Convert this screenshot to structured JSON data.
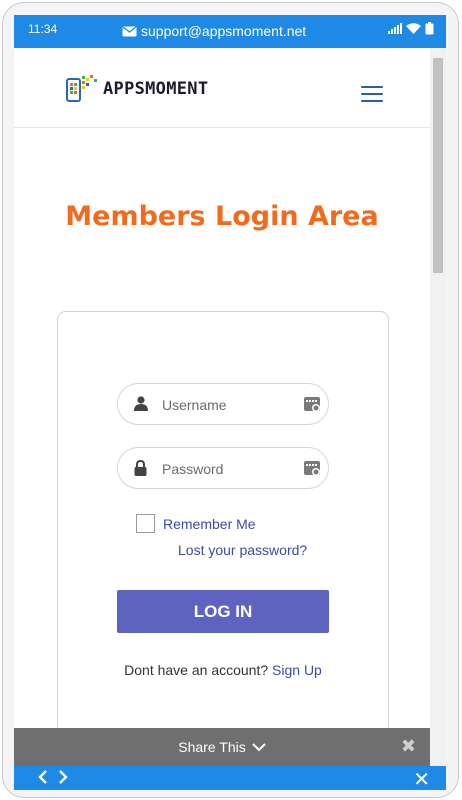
{
  "status_bar": {
    "time": "11:34",
    "email": "support@appsmoment.net",
    "icons": [
      "signal-icon",
      "wifi-icon",
      "battery-icon"
    ]
  },
  "header": {
    "logo_text": "APPSMOMENT",
    "menu_icon": "hamburger-menu-icon"
  },
  "page": {
    "title": "Members Login Area"
  },
  "login_form": {
    "username_placeholder": "Username",
    "password_placeholder": "Password",
    "remember_label": "Remember Me",
    "lost_password": "Lost your password?",
    "login_button": "LOG IN",
    "signup_prompt": "Dont have an account?",
    "signup_link": "Sign Up"
  },
  "share_bar": {
    "label": "Share This"
  },
  "colors": {
    "accent_blue": "#1f8ae6",
    "title_orange": "#f26a1b",
    "button_purple": "#5e62c1",
    "link_blue": "#3b4ba8"
  }
}
